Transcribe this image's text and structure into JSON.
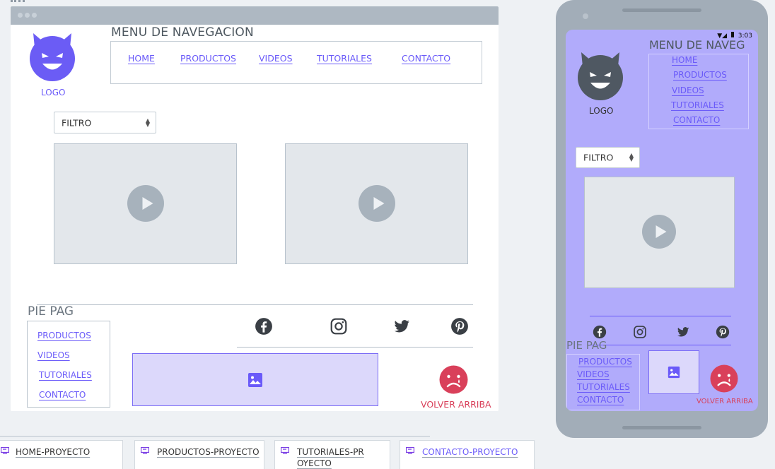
{
  "desktop": {
    "logo_label": "LOGO",
    "nav_title": "MENU DE NAVEGACION",
    "nav": [
      "HOME",
      "PRODUCTOS",
      "VIDEOS",
      "TUTORIALES",
      "CONTACTO"
    ],
    "filter_label": "FILTRO",
    "footer_title": "PIE PAG",
    "footer_links": [
      "PRODUCTOS",
      "VIDEOS",
      "TUTORIALES",
      "CONTACTO"
    ],
    "back_to_top": "VOLVER ARRIBA"
  },
  "tabs": [
    "HOME-PROYECTO",
    "PRODUCTOS-PROYECTO",
    "TUTORIALES-PROYECTO",
    "CONTACTO-PROYECTO"
  ],
  "phone": {
    "time": "3:03",
    "nav_title": "MENU DE NAVEG",
    "nav": [
      "HOME",
      "PRODUCTOS",
      "VIDEOS",
      "TUTORIALES",
      "CONTACTO"
    ],
    "logo_label": "LOGO",
    "filter_label": "FILTRO",
    "footer_title": "PIE PAG",
    "footer_links": [
      "PRODUCTOS",
      "VIDEOS",
      "TUTORIALES",
      "CONTACTO"
    ],
    "back_to_top": "VOLVER ARRIBA"
  },
  "colors": {
    "accent": "#6a5af9",
    "logo_desktop": "#6b5cf5",
    "logo_phone": "#4f5862",
    "danger": "#d9405a",
    "phone_screen": "#b1abfb"
  },
  "icons": [
    "devil-logo-icon",
    "play-icon",
    "facebook-icon",
    "instagram-icon",
    "twitter-icon",
    "pinterest-icon",
    "image-icon",
    "sad-face-icon",
    "screen-icon"
  ]
}
